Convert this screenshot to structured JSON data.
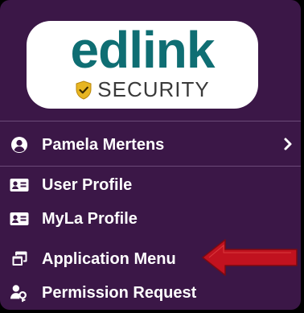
{
  "logo": {
    "wordmark": "edlink",
    "subtitle": "SECURITY",
    "wordmark_color": "#0f6e73",
    "shield_color": "#e7b521"
  },
  "menu": {
    "background": "#3b1747",
    "user": {
      "name": "Pamela Mertens",
      "icon": "user-circle-icon",
      "chevron": "chevron-right-icon"
    },
    "items": [
      {
        "label": "User Profile",
        "icon": "id-card-icon"
      },
      {
        "label": "MyLa Profile",
        "icon": "id-card-icon"
      },
      {
        "label": "Application Menu",
        "icon": "windows-stack-icon",
        "highlighted": true
      },
      {
        "label": "Permission Request",
        "icon": "user-key-icon"
      }
    ]
  },
  "annotation": {
    "type": "arrow",
    "color": "#c1121f",
    "points_to": "Application Menu"
  }
}
